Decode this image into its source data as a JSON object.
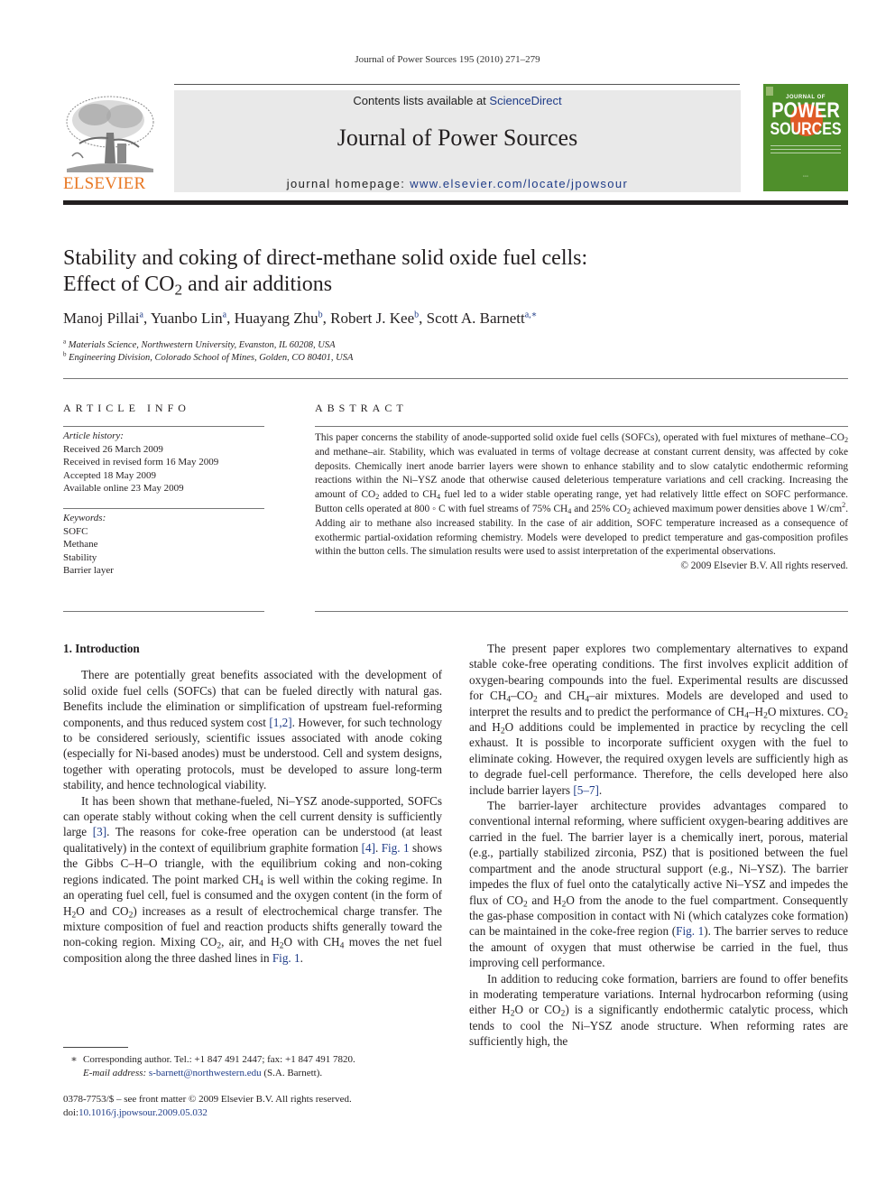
{
  "running_head": "Journal of Power Sources 195 (2010) 271–279",
  "masthead": {
    "contents_prefix": "Contents lists available at ",
    "contents_link": "ScienceDirect",
    "journal_name": "Journal of Power Sources",
    "homepage_prefix": "journal homepage: ",
    "homepage_link": "www.elsevier.com/locate/jpowsour"
  },
  "publisher": {
    "logo_text": "ELSEVIER",
    "colors": {
      "logo": "#e87722",
      "link": "#1f3c88",
      "cover": "#4f8f2b",
      "cover_accent": "#e05a26"
    }
  },
  "cover": {
    "top": "JOURNAL OF",
    "word1": "POWER",
    "word2": "SOURCES"
  },
  "article": {
    "title_line1": "Stability and coking of direct-methane solid oxide fuel cells:",
    "title_line2_a": "Effect of CO",
    "title_line2_sub": "2",
    "title_line2_b": " and air additions",
    "authors": [
      {
        "name": "Manoj Pillai",
        "aff": "a"
      },
      {
        "name": "Yuanbo Lin",
        "aff": "a"
      },
      {
        "name": "Huayang Zhu",
        "aff": "b"
      },
      {
        "name": "Robert J. Kee",
        "aff": "b"
      },
      {
        "name": "Scott A. Barnett",
        "aff": "a,∗"
      }
    ],
    "affiliations": [
      {
        "mark": "a",
        "text": "Materials Science, Northwestern University, Evanston, IL 60208, USA"
      },
      {
        "mark": "b",
        "text": "Engineering Division, Colorado School of Mines, Golden, CO 80401, USA"
      }
    ]
  },
  "article_info": {
    "heading": "ARTICLE INFO",
    "history_label": "Article history:",
    "history": [
      "Received 26 March 2009",
      "Received in revised form 16 May 2009",
      "Accepted 18 May 2009",
      "Available online 23 May 2009"
    ],
    "keywords_label": "Keywords:",
    "keywords": [
      "SOFC",
      "Methane",
      "Stability",
      "Barrier layer"
    ]
  },
  "abstract": {
    "heading": "ABSTRACT",
    "s1": "This paper concerns the stability of anode-supported solid oxide fuel cells (SOFCs), operated with fuel mixtures of methane–CO",
    "s2": " and methane–air. Stability, which was evaluated in terms of voltage decrease at constant current density, was affected by coke deposits. Chemically inert anode barrier layers were shown to enhance stability and to slow catalytic endothermic reforming reactions within the Ni–YSZ anode that otherwise caused deleterious temperature variations and cell cracking. Increasing the amount of CO",
    "s3": " added to CH",
    "s4": " fuel led to a wider stable operating range, yet had relatively little effect on SOFC performance. Button cells operated at 800 ◦ C with fuel streams of 75% CH",
    "s5": " and 25% CO",
    "s6": " achieved maximum power densities above 1 W/cm",
    "s7": ". Adding air to methane also increased stability. In the case of air addition, SOFC temperature increased as a consequence of exothermic partial-oxidation reforming chemistry. Models were developed to predict temperature and gas-composition profiles within the button cells. The simulation results were used to assist interpretation of the experimental observations.",
    "copyright": "© 2009 Elsevier B.V. All rights reserved."
  },
  "body": {
    "section_heading": "1.  Introduction",
    "p1_a": "There are potentially great benefits associated with the development of solid oxide fuel cells (SOFCs) that can be fueled directly with natural gas. Benefits include the elimination or simplification of upstream fuel-reforming components, and thus reduced system cost ",
    "p1_ref": "[1,2]",
    "p1_b": ". However, for such technology to be considered seriously, scientific issues associated with anode coking (especially for Ni-based anodes) must be understood. Cell and system designs, together with operating protocols, must be developed to assure long-term stability, and hence technological viability.",
    "p2_a": "It has been shown that methane-fueled, Ni–YSZ anode-supported, SOFCs can operate stably without coking when the cell current density is sufficiently large ",
    "p2_ref1": "[3]",
    "p2_b": ". The reasons for coke-free operation can be understood (at least qualitatively) in the context of equilibrium graphite formation ",
    "p2_ref2": "[4]",
    "p2_c": ". ",
    "p2_fig1": "Fig. 1",
    "p2_d": " shows the Gibbs C–H–O triangle, with the equilibrium coking and non-coking regions indicated. The point marked CH",
    "p2_e": " is well within the coking regime. In an operating fuel cell, fuel is consumed and the oxygen content (in the form of H",
    "p2_f": "O and CO",
    "p2_g": ") increases as a result of electrochemical charge transfer. The mixture composition of fuel and reaction products shifts generally toward the non-coking region. Mixing CO",
    "p2_h": ", air, and H",
    "p2_i": "O with CH",
    "p2_j": " moves the net fuel composition along the three dashed lines in ",
    "p2_fig2": "Fig. 1",
    "p2_k": ".",
    "p3_a": "The present paper explores two complementary alternatives to expand stable coke-free operating conditions. The first involves explicit addition of oxygen-bearing compounds into the fuel. Experimental results are discussed for CH",
    "p3_b": "–CO",
    "p3_c": " and CH",
    "p3_d": "–air mixtures. Models are developed and used to interpret the results and to predict the performance of CH",
    "p3_e": "–H",
    "p3_f": "O mixtures. CO",
    "p3_g": " and H",
    "p3_h": "O additions could be implemented in practice by recycling the cell exhaust. It is possible to incorporate sufficient oxygen with the fuel to eliminate coking. However, the required oxygen levels are sufficiently high as to degrade fuel-cell performance. Therefore, the cells developed here also include barrier layers ",
    "p3_ref": "[5–7]",
    "p3_i": ".",
    "p4_a": "The barrier-layer architecture provides advantages compared to conventional internal reforming, where sufficient oxygen-bearing additives are carried in the fuel. The barrier layer is a chemically inert, porous, material (e.g., partially stabilized zirconia, PSZ) that is positioned between the fuel compartment and the anode structural support (e.g., Ni–YSZ). The barrier impedes the flux of fuel onto the catalytically active Ni–YSZ and impedes the flux of CO",
    "p4_b": " and H",
    "p4_c": "O from the anode to the fuel compartment. Consequently the gas-phase composition in contact with Ni (which catalyzes coke formation) can be maintained in the coke-free region (",
    "p4_fig": "Fig. 1",
    "p4_d": "). The barrier serves to reduce the amount of oxygen that must otherwise be carried in the fuel, thus improving cell performance.",
    "p5_a": "In addition to reducing coke formation, barriers are found to offer benefits in moderating temperature variations. Internal hydrocarbon reforming (using either H",
    "p5_b": "O or CO",
    "p5_c": ") is a significantly endothermic catalytic process, which tends to cool the Ni–YSZ anode structure. When reforming rates are sufficiently high, the",
    "sub2": "2",
    "sub4": "4",
    "sup2": "2"
  },
  "footnotes": {
    "star": "∗",
    "corresponding": "Corresponding author. Tel.: +1 847 491 2447; fax: +1 847 491 7820.",
    "email_label": "E-mail address:",
    "email": "s-barnett@northwestern.edu",
    "email_suffix": " (S.A. Barnett).",
    "issn": "0378-7753/$ – see front matter © 2009 Elsevier B.V. All rights reserved.",
    "doi_label": "doi:",
    "doi": "10.1016/j.jpowsour.2009.05.032"
  }
}
